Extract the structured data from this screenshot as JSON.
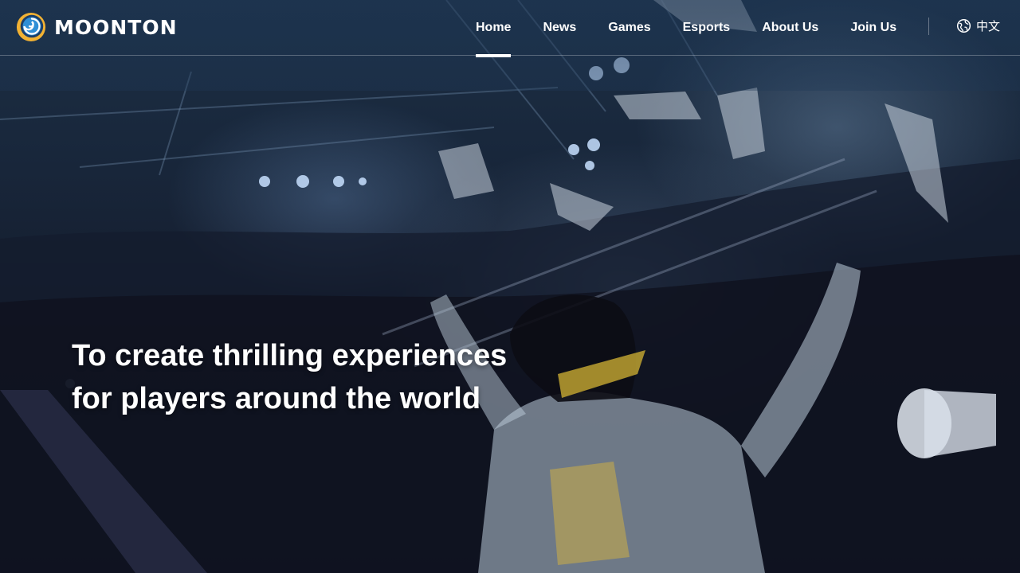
{
  "brand": {
    "name": "MOONTON",
    "logo_icon": "moonton-swirl-logo",
    "colors": {
      "logo_ring": "#f2b233",
      "logo_swirl": "#2f8fd6"
    }
  },
  "nav": {
    "items": [
      {
        "label": "Home",
        "active": true
      },
      {
        "label": "News",
        "active": false
      },
      {
        "label": "Games",
        "active": false
      },
      {
        "label": "Esports",
        "active": false
      },
      {
        "label": "About Us",
        "active": false
      },
      {
        "label": "Join Us",
        "active": false
      }
    ]
  },
  "language": {
    "icon": "globe-icon",
    "label": "中文"
  },
  "hero": {
    "headline_line1": "To create thrilling experiences",
    "headline_line2": "for players around the world"
  }
}
